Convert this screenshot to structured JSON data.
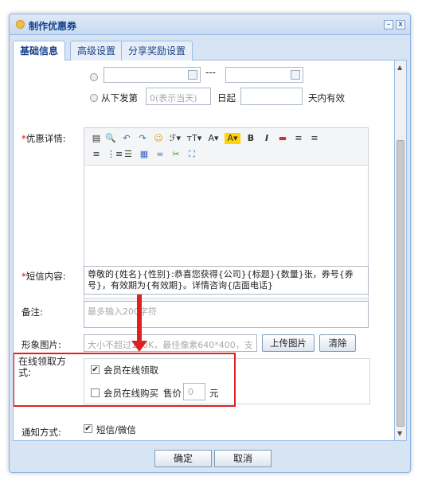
{
  "window": {
    "title": "制作优惠券",
    "minimize_label": "–",
    "close_label": "x"
  },
  "tabs": [
    {
      "label": "基础信息",
      "active": true
    },
    {
      "label": "高级设置",
      "active": false
    },
    {
      "label": "分享奖励设置",
      "active": false
    }
  ],
  "validity": {
    "date_range_separator": "---",
    "relative_prefix": "从下发第",
    "relative_placeholder": "0(表示当天)",
    "day_label": "日起",
    "days_valid_suffix": "天内有效"
  },
  "details": {
    "label": "优惠详情:",
    "required_mark": "*"
  },
  "sms": {
    "label": "短信内容:",
    "required_mark": "*",
    "value": "尊敬的{姓名}{性别}:恭喜您获得{公司}{标题}{数量}张，券号{券号}，有效期为{有效期}。详情咨询{店面电话}"
  },
  "remark": {
    "label": "备注:",
    "placeholder": "最多输入200字符"
  },
  "image": {
    "label": "形象图片:",
    "hint": "大小不超过100K，最佳像素640*400，支",
    "upload_label": "上传图片",
    "clear_label": "清除"
  },
  "online": {
    "label": "在线领取方式:",
    "option_receive": "会员在线领取",
    "option_receive_checked": true,
    "option_buy": "会员在线购买",
    "option_buy_checked": false,
    "price_label": "售价",
    "price_placeholder": "0",
    "currency": "元"
  },
  "notify": {
    "label": "通知方式:",
    "option": "短信/微信",
    "checked": true
  },
  "footer": {
    "confirm_label": "确定",
    "cancel_label": "取消"
  },
  "colors": {
    "accent": "#15428b",
    "highlight": "#e02020",
    "required": "#ee0000"
  }
}
